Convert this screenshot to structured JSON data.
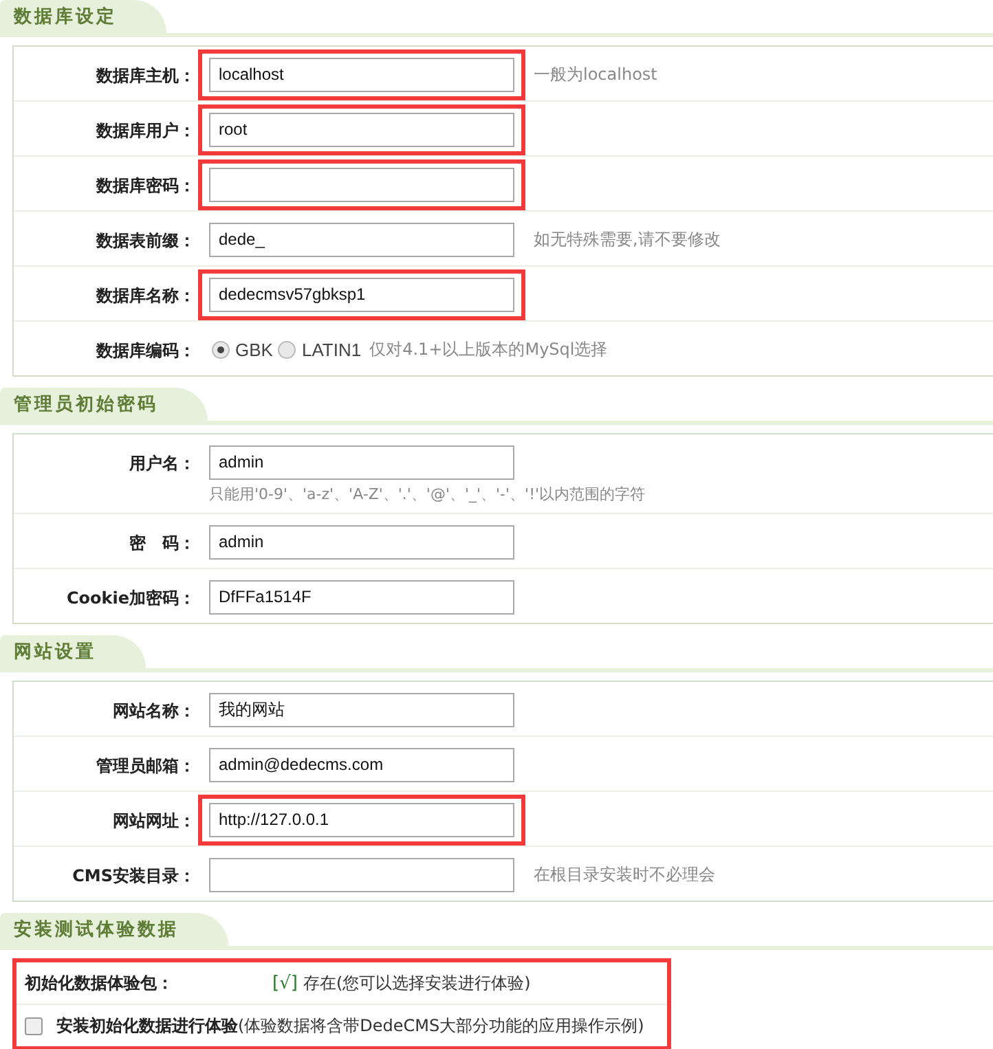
{
  "sections": [
    {
      "title": "数据库设定",
      "highlighted": false,
      "rows": [
        {
          "kind": "input",
          "label": "数据库主机：",
          "value": "localhost",
          "highlighted": true,
          "hint": "一般为localhost"
        },
        {
          "kind": "input",
          "label": "数据库用户：",
          "value": "root",
          "highlighted": true
        },
        {
          "kind": "input",
          "label": "数据库密码：",
          "highlighted": true
        },
        {
          "kind": "input",
          "label": "数据表前缀：",
          "value": "dede_",
          "highlighted": false,
          "hint": "如无特殊需要,请不要修改"
        },
        {
          "kind": "input",
          "label": "数据库名称：",
          "value": "dedecmsv57gbksp1",
          "highlighted": true
        },
        {
          "kind": "radio",
          "label": "数据库编码：",
          "options": [
            {
              "label": "GBK",
              "selected": true
            },
            {
              "label": "LATIN1",
              "selected": false
            }
          ],
          "hint": "仅对4.1+以上版本的MySql选择"
        }
      ]
    },
    {
      "title": "管理员初始密码",
      "highlighted": false,
      "rows": [
        {
          "kind": "input",
          "label": "用户名：",
          "value": "admin",
          "highlighted": false,
          "note": "只能用'0-9'、'a-z'、'A-Z'、'.'、'@'、'_'、'-'、'!'以内范围的字符"
        },
        {
          "kind": "input",
          "label": "密　码：",
          "value": "admin",
          "highlighted": false
        },
        {
          "kind": "input",
          "label": "Cookie加密码：",
          "value": "DfFFa1514F",
          "highlighted": false
        }
      ]
    },
    {
      "title": "网站设置",
      "highlighted": false,
      "rows": [
        {
          "kind": "input",
          "label": "网站名称：",
          "value": "我的网站",
          "highlighted": false
        },
        {
          "kind": "input",
          "label": "管理员邮箱：",
          "value": "admin@dedecms.com",
          "highlighted": false
        },
        {
          "kind": "input",
          "label": "网站网址：",
          "value": "http://127.0.0.1",
          "highlighted": true
        },
        {
          "kind": "input",
          "label": "CMS安装目录：",
          "highlighted": false,
          "hint": "在根目录安装时不必理会"
        }
      ]
    },
    {
      "title": "安装测试体验数据",
      "highlighted": true,
      "rows": [
        {
          "kind": "status",
          "label": "初始化数据体验包：",
          "mark": "[√]",
          "text": "存在(您可以选择安装进行体验)"
        },
        {
          "kind": "checkbox",
          "label": "安装初始化数据进行体验",
          "checked": false,
          "hint": "(体验数据将含带DedeCMS大部分功能的应用操作示例)"
        }
      ]
    }
  ]
}
